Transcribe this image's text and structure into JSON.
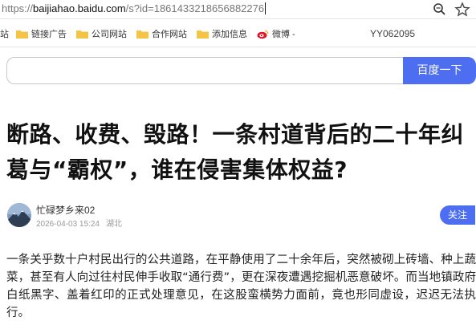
{
  "address_bar": {
    "url_prefix": "https://",
    "url_domain": "baijiahao.baidu.com",
    "url_path": "/s?id=1861433218656882276"
  },
  "bookmarks": {
    "items": [
      {
        "label": "站"
      },
      {
        "label": "链接广告"
      },
      {
        "label": "公司网站"
      },
      {
        "label": "合作网站"
      },
      {
        "label": "添加信息"
      },
      {
        "label": "微博 -"
      }
    ],
    "extra_text": "YY062095"
  },
  "search": {
    "button_label": "百度一下"
  },
  "article": {
    "title": "断路、收费、毁路！一条村道背后的二十年纠葛与“霸权”，谁在侵害集体权益?",
    "author_name": "忙碌梦乡来02",
    "publish_time": "2026-04-03 15:24",
    "location": "湖北",
    "follow_label": "关注",
    "body": "一条关乎数十户村民出行的公共道路，在平静使用了二十余年后，突然被砌上砖墙、种上蔬菜，甚至有人向过往村民伸手收取“通行费”，更在深夜遭遇挖掘机恶意破坏。而当地镇政府白纸黑字、盖着红印的正式处理意见，在这股蛮横势力面前，竟也形同虚设，迟迟无法执行。"
  },
  "colors": {
    "accent": "#4e6ef2",
    "folder": "#f3c445",
    "weibo": "#e6162d"
  },
  "icons": {
    "zoom": "magnifier-icon",
    "favorite": "star-icon",
    "bookmark": "folder-icon",
    "weibo": "weibo-icon",
    "avatar": "mountain-avatar"
  }
}
